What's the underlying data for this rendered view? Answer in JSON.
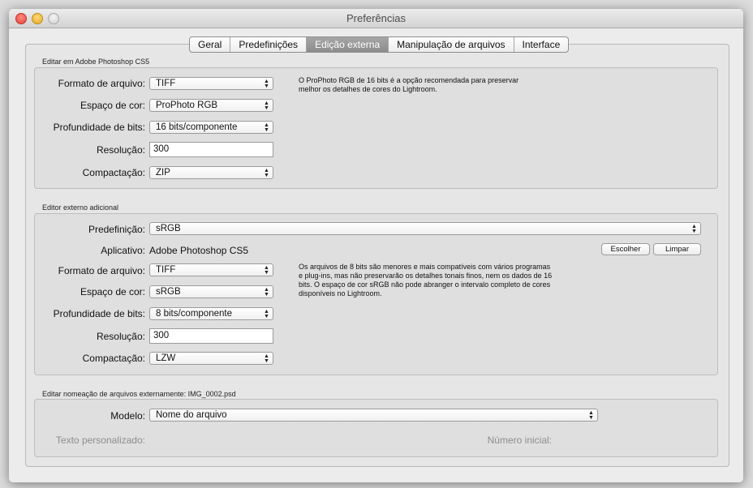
{
  "window": {
    "title": "Preferências"
  },
  "tabs": [
    {
      "label": "Geral",
      "active": false
    },
    {
      "label": "Predefinições",
      "active": false
    },
    {
      "label": "Edição externa",
      "active": true
    },
    {
      "label": "Manipulação de arquivos",
      "active": false
    },
    {
      "label": "Interface",
      "active": false
    }
  ],
  "photoshop": {
    "heading": "Editar em Adobe Photoshop CS5",
    "file_format": {
      "label": "Formato de arquivo:",
      "value": "TIFF"
    },
    "color_space": {
      "label": "Espaço de cor:",
      "value": "ProPhoto RGB"
    },
    "bit_depth": {
      "label": "Profundidade de bits:",
      "value": "16 bits/componente"
    },
    "resolution": {
      "label": "Resolução:",
      "value": "300"
    },
    "compression": {
      "label": "Compactação:",
      "value": "ZIP"
    },
    "note": "O ProPhoto RGB de 16 bits é a opção recomendada para preservar melhor os detalhes de cores do Lightroom."
  },
  "additional": {
    "heading": "Editor externo adicional",
    "preset": {
      "label": "Predefinição:",
      "value": "sRGB"
    },
    "application": {
      "label": "Aplicativo:",
      "value": "Adobe Photoshop CS5"
    },
    "choose_button": "Escolher",
    "clear_button": "Limpar",
    "file_format": {
      "label": "Formato de arquivo:",
      "value": "TIFF"
    },
    "color_space": {
      "label": "Espaço de cor:",
      "value": "sRGB"
    },
    "bit_depth": {
      "label": "Profundidade de bits:",
      "value": "8 bits/componente"
    },
    "resolution": {
      "label": "Resolução:",
      "value": "300"
    },
    "compression": {
      "label": "Compactação:",
      "value": "LZW"
    },
    "note": "Os arquivos de 8 bits são menores e mais compatíveis com vários programas e plug-ins, mas não preservarão os detalhes tonais finos, nem os dados de 16 bits. O espaço de cor sRGB não pode abranger o intervalo completo de cores disponíveis no Lightroom."
  },
  "naming": {
    "heading": "Editar nomeação de arquivos externamente:  IMG_0002.psd",
    "template": {
      "label": "Modelo:",
      "value": "Nome do arquivo"
    },
    "custom_text_label": "Texto personalizado:",
    "start_number_label": "Número inicial:"
  }
}
